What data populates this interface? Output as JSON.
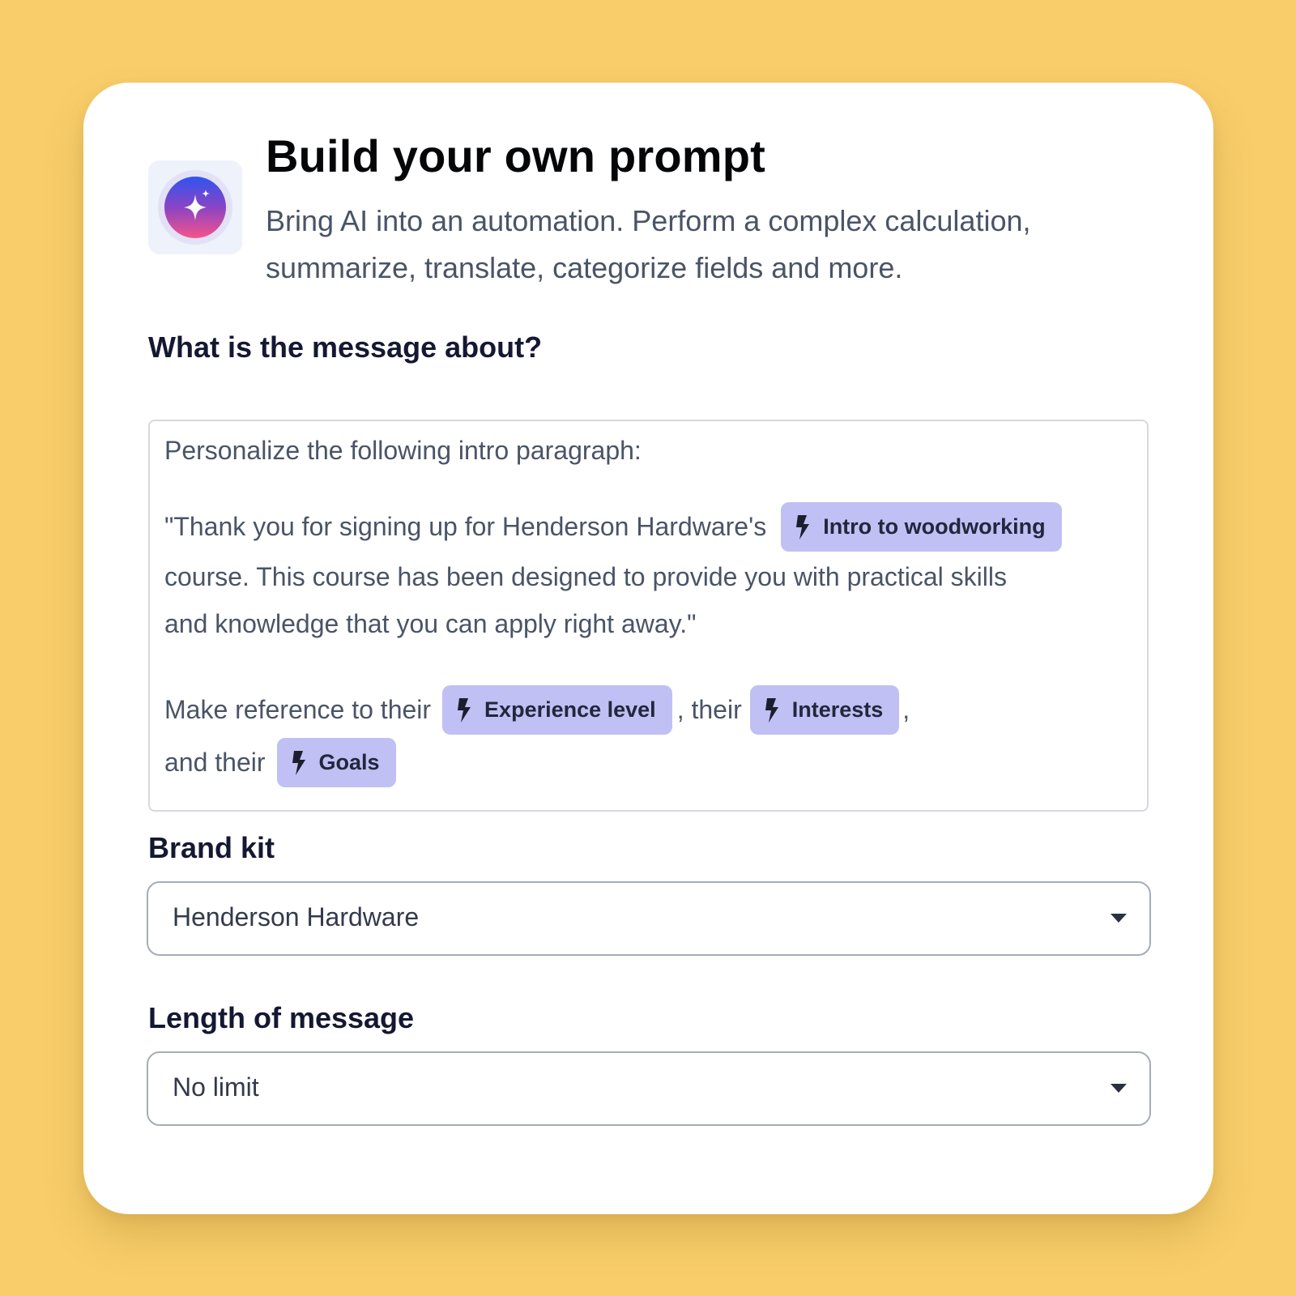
{
  "header": {
    "title": "Build your own prompt",
    "subtitle": "Bring AI into an automation. Perform a complex calculation, summarize, translate, categorize fields and more.",
    "icon": "sparkle-icon"
  },
  "prompt": {
    "label": "What is the message about?",
    "line1": "Personalize the following intro paragraph:",
    "line2_text": "\"Thank you for signing up for Henderson Hardware's",
    "line3": "course. This course has been designed to provide you with practical skills",
    "line4": "and knowledge that you can apply right away.\"",
    "line5_lead": "Make reference to their",
    "sep_their": ", their",
    "sep_comma": ",",
    "line6_lead": "and their",
    "chips": [
      {
        "label": "Intro to woodworking",
        "icon": "bolt-icon"
      },
      {
        "label": "Experience level",
        "icon": "bolt-icon"
      },
      {
        "label": "Interests",
        "icon": "bolt-icon"
      },
      {
        "label": "Goals",
        "icon": "bolt-icon"
      }
    ]
  },
  "brand_kit": {
    "label": "Brand kit",
    "value": "Henderson Hardware"
  },
  "length": {
    "label": "Length of message",
    "value": "No limit"
  },
  "colors": {
    "background": "#f8cd6a",
    "chip": "#c0c0f4",
    "orb_top": "#2f54f0",
    "orb_bottom": "#f6538a"
  }
}
